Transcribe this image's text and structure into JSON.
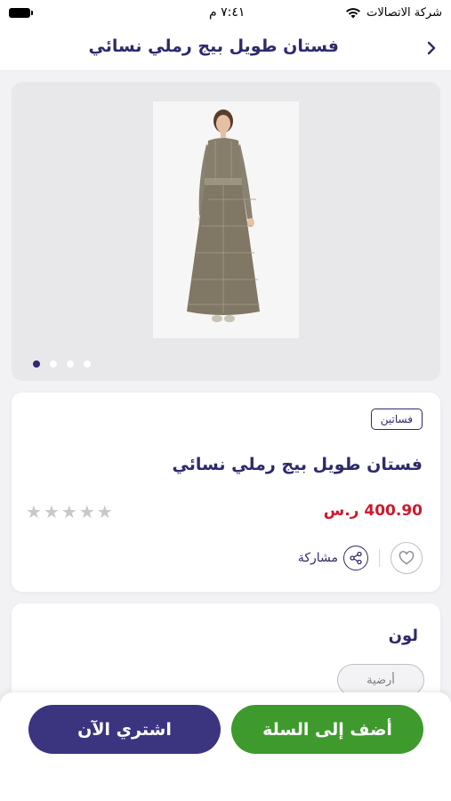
{
  "status_bar": {
    "carrier": "شركة الاتصالات",
    "time": "٧:٤١ م"
  },
  "header": {
    "title": "فستان طويل بيج رملي نسائي"
  },
  "gallery": {
    "image_count": 4,
    "active_index": 0
  },
  "product": {
    "category": "فساتين",
    "title": "فستان طويل بيج رملي نسائي",
    "price": "400.90 ر.س",
    "rating": 0,
    "max_rating": 5,
    "share_label": "مشاركة"
  },
  "colors": {
    "label": "لون",
    "selected": "أرضية"
  },
  "actions": {
    "add_to_cart": "أضف إلى السلة",
    "buy_now": "اشتري الآن"
  },
  "theme": {
    "primary": "#2e2a6b",
    "price_color": "#cc1a2b",
    "cart_green": "#3e9a2c",
    "buy_purple": "#3b3580"
  }
}
